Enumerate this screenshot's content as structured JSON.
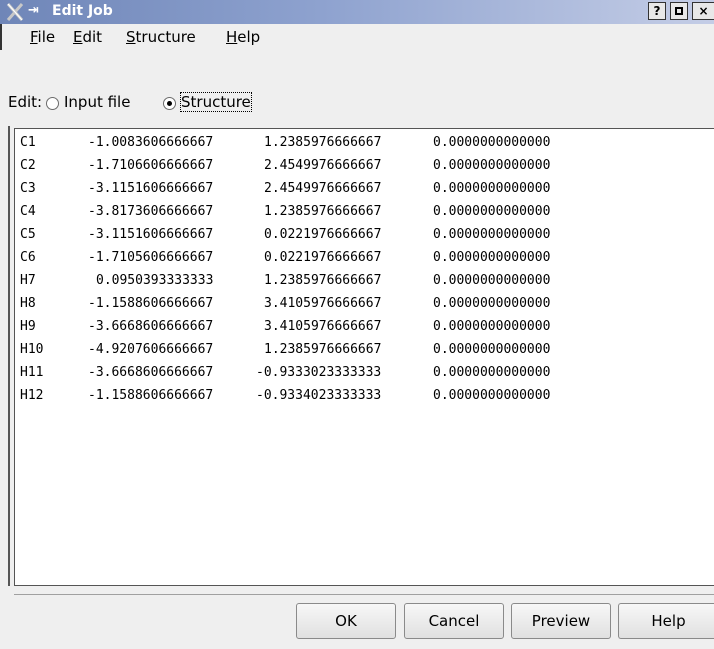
{
  "window": {
    "title": "Edit Job",
    "buttons": [
      "?",
      "□",
      "×"
    ]
  },
  "menu": {
    "items": [
      {
        "label": "File",
        "mnemonic": "F",
        "rest": "ile"
      },
      {
        "label": "Edit",
        "mnemonic": "E",
        "rest": "dit"
      },
      {
        "label": "Structure",
        "mnemonic": "S",
        "rest": "tructure"
      },
      {
        "label": "Help",
        "mnemonic": "H",
        "rest": "elp"
      }
    ]
  },
  "edit_mode": {
    "label": "Edit:",
    "options": [
      {
        "label": "Input file",
        "selected": false
      },
      {
        "label": "Structure",
        "selected": true
      }
    ]
  },
  "structure": {
    "rows": [
      [
        "C1",
        "-1.0083606666667",
        "1.2385976666667",
        "0.0000000000000"
      ],
      [
        "C2",
        "-1.7106606666667",
        "2.4549976666667",
        "0.0000000000000"
      ],
      [
        "C3",
        "-3.1151606666667",
        "2.4549976666667",
        "0.0000000000000"
      ],
      [
        "C4",
        "-3.8173606666667",
        "1.2385976666667",
        "0.0000000000000"
      ],
      [
        "C5",
        "-3.1151606666667",
        "0.0221976666667",
        "0.0000000000000"
      ],
      [
        "C6",
        "-1.7105606666667",
        "0.0221976666667",
        "0.0000000000000"
      ],
      [
        "H7",
        "0.0950393333333",
        "1.2385976666667",
        "0.0000000000000"
      ],
      [
        "H8",
        "-1.1588606666667",
        "3.4105976666667",
        "0.0000000000000"
      ],
      [
        "H9",
        "-3.6668606666667",
        "3.4105976666667",
        "0.0000000000000"
      ],
      [
        "H10",
        "-4.9207606666667",
        "1.2385976666667",
        "0.0000000000000"
      ],
      [
        "H11",
        "-3.6668606666667",
        "-0.9333023333333",
        "0.0000000000000"
      ],
      [
        "H12",
        "-1.1588606666667",
        "-0.9334023333333",
        "0.0000000000000"
      ]
    ]
  },
  "buttons": {
    "ok": "OK",
    "cancel": "Cancel",
    "preview": "Preview",
    "help": "Help"
  }
}
